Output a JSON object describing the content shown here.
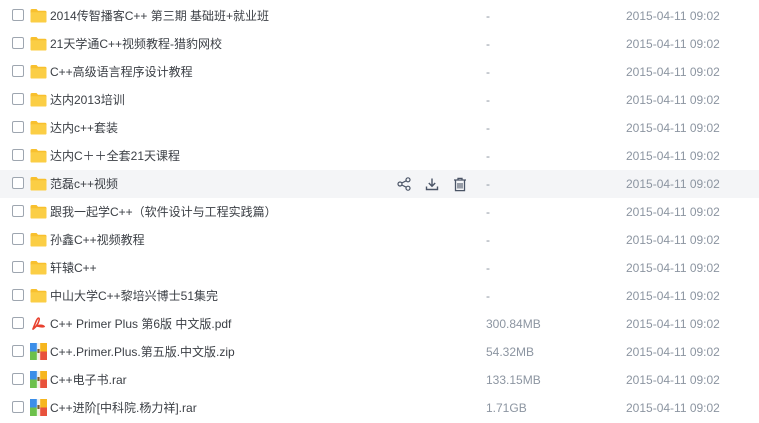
{
  "colors": {
    "folder": "#f8c02e",
    "pdf": "#e8412f",
    "archive_blue": "#3c8ee8",
    "text": "#3b3f45",
    "muted": "#8c95a1",
    "hover": "#f4f5f7"
  },
  "hover_actions": [
    "share-icon",
    "download-icon",
    "delete-icon"
  ],
  "files": [
    {
      "name": "2014传智播客C++ 第三期 基础班+就业班",
      "size": "-",
      "date": "2015-04-11 09:02",
      "icon": "folder-icon"
    },
    {
      "name": "21天学通C++视频教程-猎豹网校",
      "size": "-",
      "date": "2015-04-11 09:02",
      "icon": "folder-icon"
    },
    {
      "name": "C++高级语言程序设计教程",
      "size": "-",
      "date": "2015-04-11 09:02",
      "icon": "folder-icon"
    },
    {
      "name": "达内2013培训",
      "size": "-",
      "date": "2015-04-11 09:02",
      "icon": "folder-icon"
    },
    {
      "name": "达内c++套装",
      "size": "-",
      "date": "2015-04-11 09:02",
      "icon": "folder-icon"
    },
    {
      "name": "达内C＋＋全套21天课程",
      "size": "-",
      "date": "2015-04-11 09:02",
      "icon": "folder-icon"
    },
    {
      "name": "范磊c++视频",
      "size": "-",
      "date": "2015-04-11 09:02",
      "icon": "folder-icon",
      "hovered": true
    },
    {
      "name": "跟我一起学C++（软件设计与工程实践篇）",
      "size": "-",
      "date": "2015-04-11 09:02",
      "icon": "folder-icon"
    },
    {
      "name": "孙鑫C++视频教程",
      "size": "-",
      "date": "2015-04-11 09:02",
      "icon": "folder-icon"
    },
    {
      "name": "轩辕C++",
      "size": "-",
      "date": "2015-04-11 09:02",
      "icon": "folder-icon"
    },
    {
      "name": "中山大学C++黎培兴博士51集完",
      "size": "-",
      "date": "2015-04-11 09:02",
      "icon": "folder-icon"
    },
    {
      "name": "C++ Primer Plus  第6版  中文版.pdf",
      "size": "300.84MB",
      "date": "2015-04-11 09:02",
      "icon": "pdf-icon"
    },
    {
      "name": "C++.Primer.Plus.第五版.中文版.zip",
      "size": "54.32MB",
      "date": "2015-04-11 09:02",
      "icon": "archive-icon"
    },
    {
      "name": "C++电子书.rar",
      "size": "133.15MB",
      "date": "2015-04-11 09:02",
      "icon": "archive-icon"
    },
    {
      "name": "C++进阶[中科院.杨力祥].rar",
      "size": "1.71GB",
      "date": "2015-04-11 09:02",
      "icon": "archive-icon"
    }
  ]
}
